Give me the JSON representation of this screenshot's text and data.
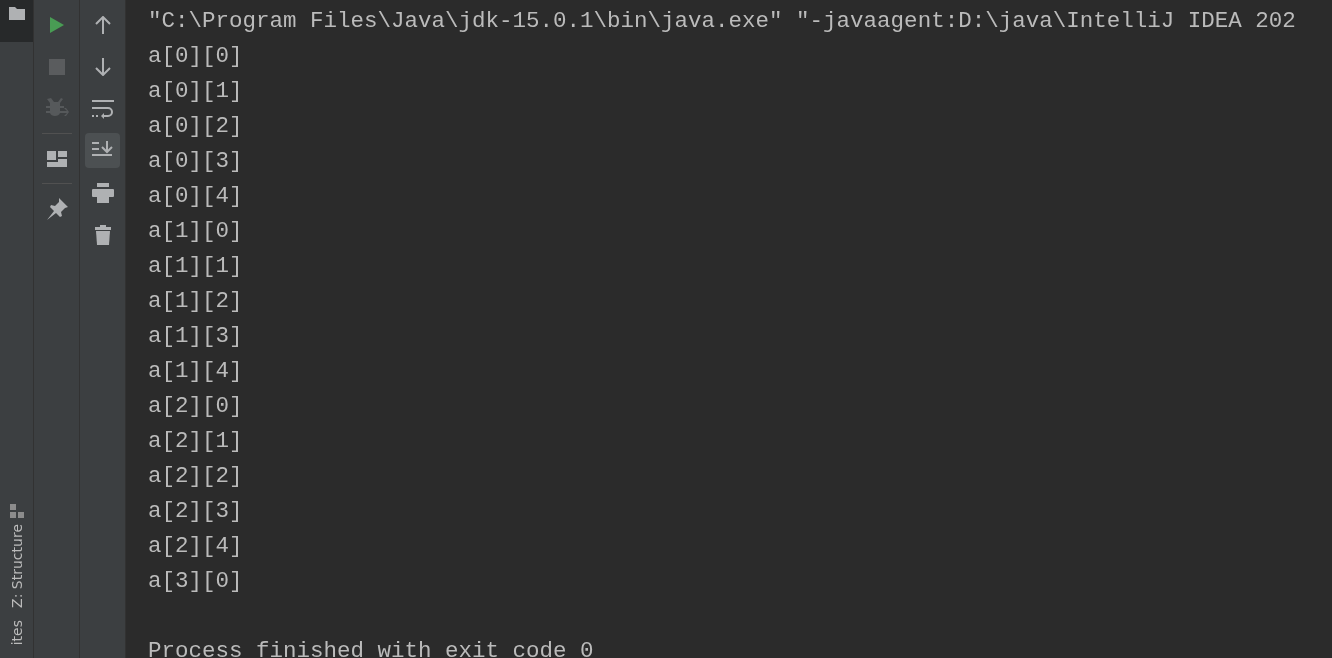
{
  "left_strip": {
    "tabs": [
      {
        "kind": "project",
        "selected": true
      }
    ],
    "labels": [
      {
        "kind": "structure",
        "text": "Z: Structure"
      },
      {
        "kind": "plain",
        "text": "ites"
      }
    ]
  },
  "run_toolbar": [
    {
      "kind": "run",
      "disabled": false
    },
    {
      "kind": "stop",
      "disabled": true
    },
    {
      "kind": "debug",
      "disabled": true
    },
    {
      "kind": "separator"
    },
    {
      "kind": "layout",
      "disabled": false
    },
    {
      "kind": "separator"
    },
    {
      "kind": "pin",
      "disabled": false
    }
  ],
  "console_toolbar": [
    {
      "kind": "up",
      "on": false
    },
    {
      "kind": "down",
      "on": false
    },
    {
      "kind": "wrap",
      "on": false
    },
    {
      "kind": "scroll-end",
      "on": true
    },
    {
      "kind": "print",
      "on": false
    },
    {
      "kind": "trash",
      "on": false
    }
  ],
  "console": {
    "lines": [
      "\"C:\\Program Files\\Java\\jdk-15.0.1\\bin\\java.exe\" \"-javaagent:D:\\java\\IntelliJ IDEA 202",
      "a[0][0]",
      "a[0][1]",
      "a[0][2]",
      "a[0][3]",
      "a[0][4]",
      "a[1][0]",
      "a[1][1]",
      "a[1][2]",
      "a[1][3]",
      "a[1][4]",
      "a[2][0]",
      "a[2][1]",
      "a[2][2]",
      "a[2][3]",
      "a[2][4]",
      "a[3][0]"
    ],
    "exit_message": "Process finished with exit code 0"
  }
}
